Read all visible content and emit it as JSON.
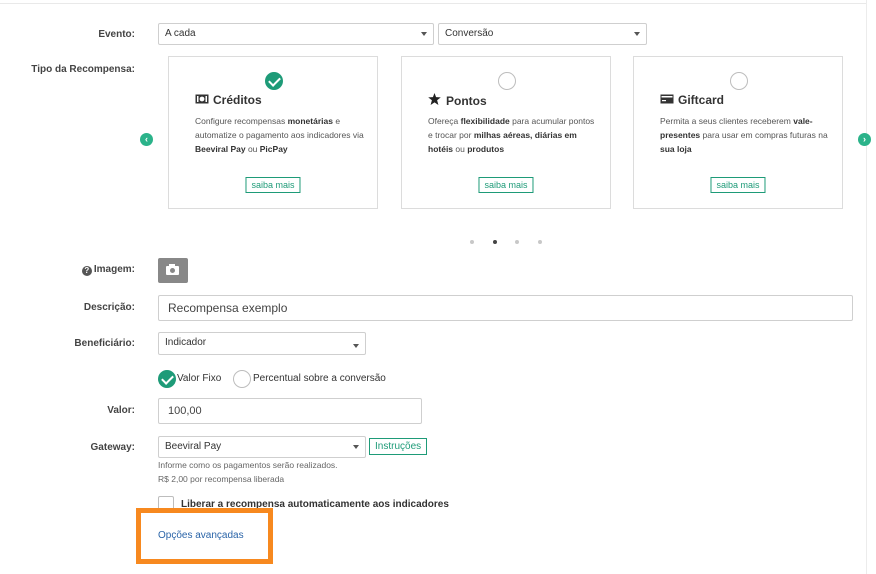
{
  "labels": {
    "evento": "Evento:",
    "tipo": "Tipo da Recompensa:",
    "imagem": "Imagem:",
    "descricao": "Descrição:",
    "beneficiario": "Beneficiário:",
    "valor": "Valor:",
    "gateway": "Gateway:"
  },
  "evento": {
    "select1": "A cada",
    "select2": "Conversão"
  },
  "cards": [
    {
      "title": "Créditos",
      "icon": "money-icon",
      "selected": true,
      "desc_parts": [
        "Configure recompensas ",
        "monetárias",
        " e automatize o pagamento aos indicadores via ",
        "Beeviral Pay",
        " ou ",
        "PicPay"
      ],
      "button": "saiba mais"
    },
    {
      "title": "Pontos",
      "icon": "star-icon",
      "selected": false,
      "desc_parts": [
        "Ofereça ",
        "flexibilidade",
        " para acumular pontos e trocar por ",
        "milhas aéreas, diárias em hotéis",
        " ou ",
        "produtos"
      ],
      "button": "saiba mais"
    },
    {
      "title": "Giftcard",
      "icon": "giftcard-icon",
      "selected": false,
      "desc_parts": [
        "Permita a seus clientes receberem ",
        "vale-presentes",
        " para usar em compras futuras na ",
        "sua loja",
        "",
        ""
      ],
      "button": "saiba mais"
    }
  ],
  "carousel": {
    "dots": 4,
    "active": 1,
    "prev": "‹",
    "next": "›"
  },
  "descricao": {
    "value": "Recompensa exemplo"
  },
  "beneficiario": {
    "value": "Indicador"
  },
  "tipo_valor": {
    "fixo": "Valor Fixo",
    "percentual": "Percentual sobre a conversão",
    "selected": "fixo"
  },
  "valor": {
    "value": "100,00"
  },
  "gateway": {
    "value": "Beeviral Pay",
    "instrucoes": "Instruções",
    "help1": "Informe como os pagamentos serão realizados.",
    "help2": "R$ 2,00 por recompensa liberada"
  },
  "liberar": {
    "label": "Liberar a recompensa automaticamente aos indicadores",
    "checked": false
  },
  "opcoes_avancadas": "Opções avançadas",
  "colors": {
    "accent": "#1e9b78",
    "highlight": "#f7891f",
    "link": "#2a64a8"
  }
}
